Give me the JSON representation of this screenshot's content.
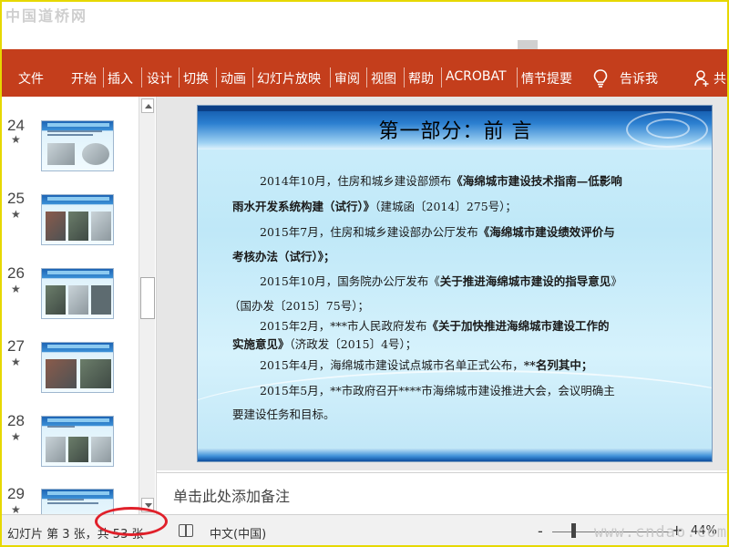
{
  "watermark_top": "中国道桥网",
  "watermark_bottom": "www.cndao.com",
  "colors": {
    "ribbon": "#c43e1c",
    "annotation_circle": "#e0202a"
  },
  "ribbon": {
    "tabs": [
      "文件",
      "开始",
      "插入",
      "设计",
      "切换",
      "动画",
      "幻灯片放映",
      "审阅",
      "视图",
      "帮助",
      "ACROBAT",
      "情节提要"
    ],
    "tell_me": "告诉我",
    "share": "共",
    "icons": {
      "tell_me": "lightbulb-icon",
      "share": "person-add-icon"
    }
  },
  "thumbnails": [
    {
      "num": "24",
      "star": "★"
    },
    {
      "num": "25",
      "star": "★"
    },
    {
      "num": "26",
      "star": "★"
    },
    {
      "num": "27",
      "star": "★"
    },
    {
      "num": "28",
      "star": "★"
    },
    {
      "num": "29",
      "star": "★"
    }
  ],
  "slide": {
    "title": "第一部分：前 言",
    "paragraphs": [
      {
        "l1_pre": "2014年10月，住房和城乡建设部颁布",
        "l1_bold": "《海绵城市建设技术指南—低影响",
        "l2_bold": "雨水开发系统构建（试行）》",
        "l2_post": "（建城函〔2014〕275号）；"
      },
      {
        "l1_pre": "2015年7月，住房和城乡建设部办公厅发布",
        "l1_bold": "《海绵城市建设绩效评价与",
        "l2_bold": "考核办法（试行）》；"
      },
      {
        "l1_pre": "2015年10月，国务院办公厅发布《",
        "l1_bold": "关于推进海绵城市建设的指导意见",
        "l1_post": "》",
        "l2_post": "（国办发〔2015〕75号）；"
      },
      {
        "l1_pre": "2015年2月，***市人民政府发布",
        "l1_bold": "《关于加快推进海绵城市建设工作的",
        "l2_bold": "实施意见》",
        "l2_post": "（济政发〔2015〕4号）；"
      },
      {
        "l1_pre": "2015年4月，海绵城市建设试点城市名单正式公布，",
        "l1_bold": "**名列其中；"
      },
      {
        "l1_pre": "2015年5月，**市政府召开****市海绵城市建设推进大会，会议明确主",
        "l2_post": "要建设任务和目标。"
      }
    ]
  },
  "notes_placeholder": "单击此处添加备注",
  "status": {
    "slide_info": "幻灯片 第 3 张，共 53 张",
    "language": "中文(中国)",
    "zoom_minus": "-",
    "zoom_plus": "+",
    "zoom": "44%"
  }
}
